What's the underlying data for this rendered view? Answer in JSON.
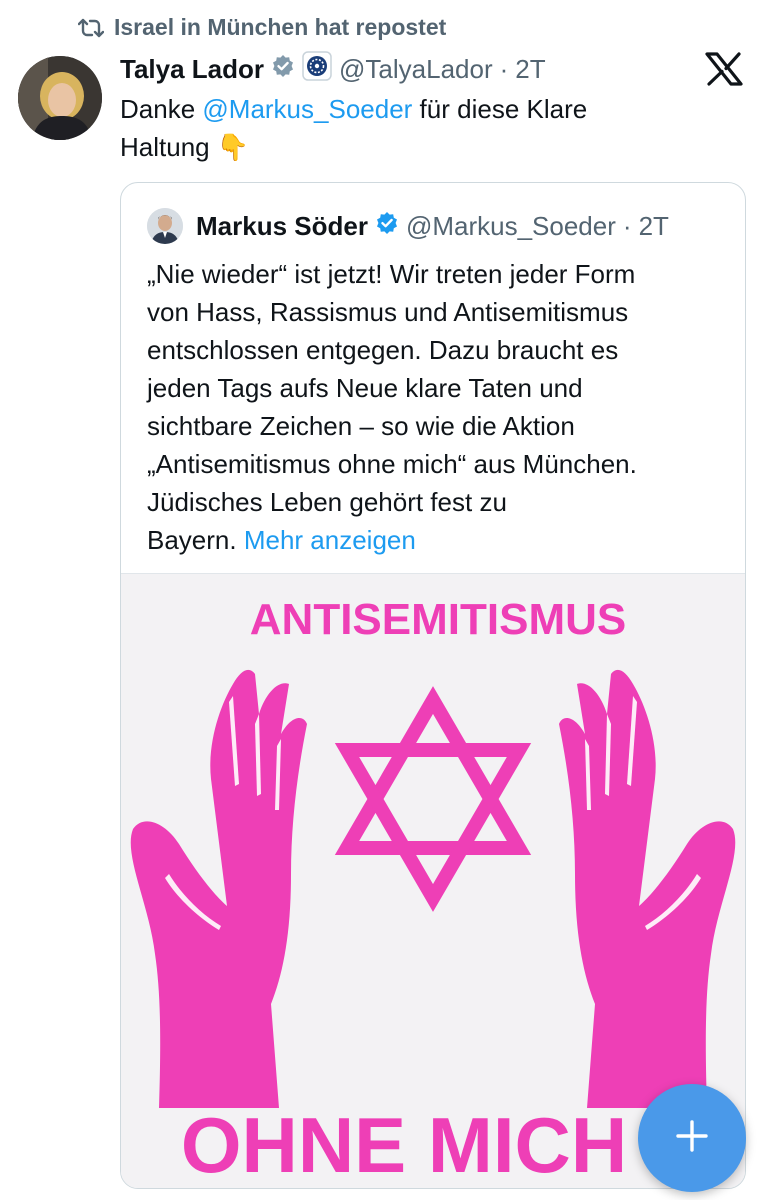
{
  "repost": {
    "text": "Israel in München hat repostet"
  },
  "tweet": {
    "author_name": "Talya Lador",
    "handle": "@TalyaLador",
    "separator": "·",
    "time": "2T",
    "text_prefix": "Danke ",
    "mention": "@Markus_Soeder",
    "text_suffix": " für diese Klare Haltung ",
    "emoji": "👇"
  },
  "quote": {
    "author_name": "Markus Söder",
    "handle": "@Markus_Soeder",
    "separator": "·",
    "time": "2T",
    "text": "„Nie wieder“ ist jetzt! Wir treten jeder Form\nvon Hass, Rassismus und Antisemitismus\nentschlossen entgegen. Dazu braucht es\njeden Tags aufs Neue klare Taten und\nsichtbare Zeichen – so wie die Aktion\n„Antisemitismus ohne mich“ aus München.\nJüdisches Leben gehört fest zu\nBayern. ",
    "more_label": "Mehr anzeigen",
    "image": {
      "top_text": "ANTISEMITISMUS",
      "bottom_text": "OHNE MICH",
      "accent": "#ee3fb6",
      "background": "#f3f2f4"
    }
  },
  "fab": {
    "label": "+",
    "color": "#4a99e9"
  },
  "icons": {
    "repost": "repost-icon",
    "verified": "verified-badge-icon",
    "affiliate": "affiliate-badge-icon",
    "platform": "x-logo-icon",
    "compose": "plus-icon"
  },
  "colors": {
    "link": "#1d9bf0",
    "secondary_text": "#536471",
    "verified": "#1d9bf0"
  }
}
